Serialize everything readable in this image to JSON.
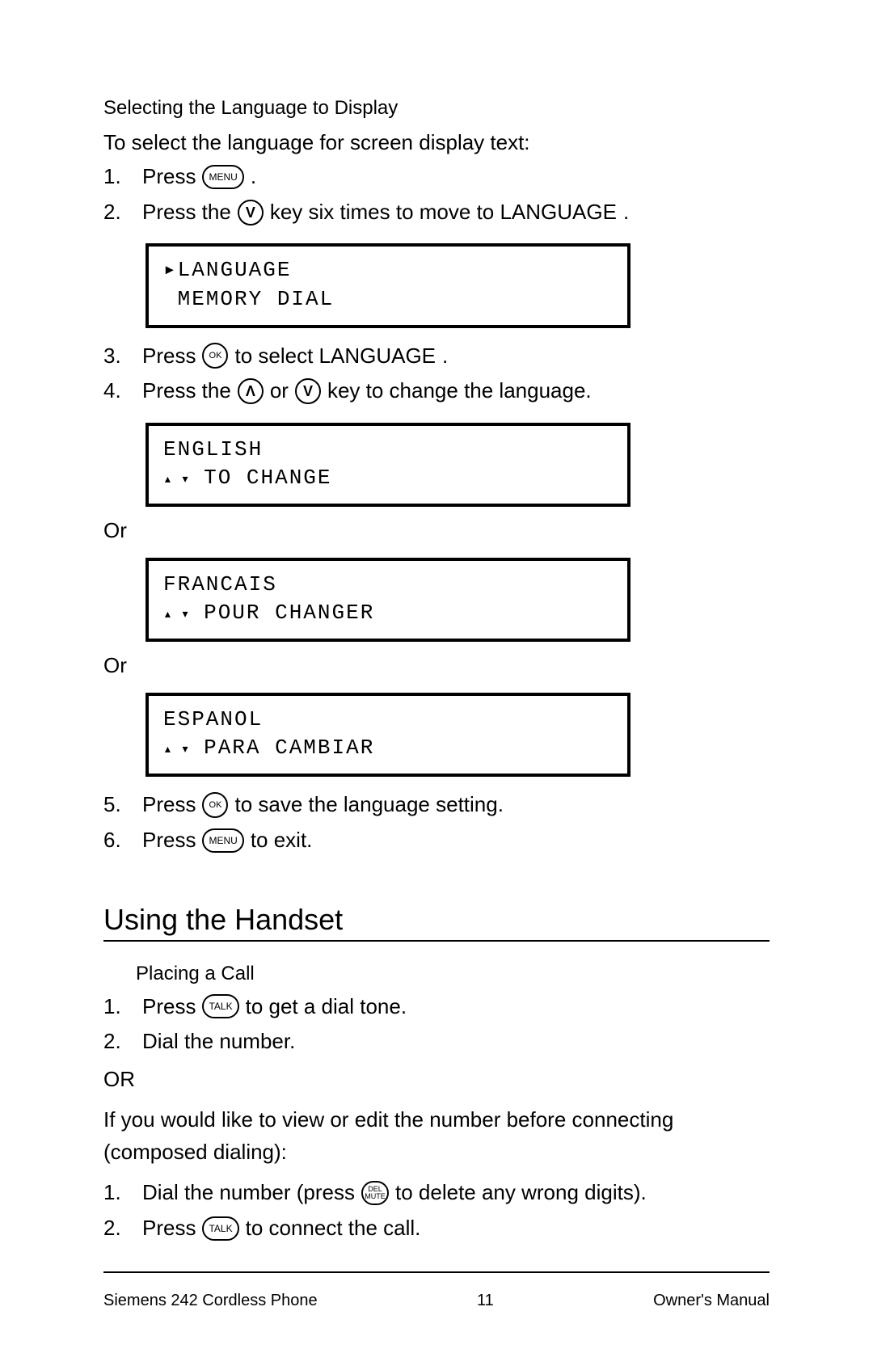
{
  "buttons": {
    "menu": "MENU",
    "down": "V",
    "up": "Λ",
    "ok": "OK",
    "talk": "TALK",
    "del_top": "DEL",
    "del_bot": "MUTE"
  },
  "sec1": {
    "heading": "Selecting the Language to Display",
    "intro": "To select the language for screen display text:",
    "step1_a": "1.",
    "step1_b": "Press",
    "step1_c": ".",
    "step2_a": "2.",
    "step2_b": "Press the",
    "step2_c": "key six times to move to LANGUAGE",
    "step2_d": ".",
    "lcd1_line1": "▸LANGUAGE",
    "lcd1_line2": " MEMORY DIAL",
    "step3_a": "3.",
    "step3_b": "Press",
    "step3_c": "to select LANGUAGE",
    "step3_d": ".",
    "step4_a": "4.",
    "step4_b": "Press the",
    "step4_c": "or",
    "step4_d": "key to change the language.",
    "lcd2_line1": "ENGLISH",
    "lcd2_line2_arrows": "▴ ▾",
    "lcd2_line2_text": " TO CHANGE",
    "or1": "Or",
    "lcd3_line1": "FRANCAIS",
    "lcd3_line2_arrows": "▴ ▾",
    "lcd3_line2_text": " POUR CHANGER",
    "or2": "Or",
    "lcd4_line1": "ESPANOL",
    "lcd4_line2_arrows": "▴ ▾",
    "lcd4_line2_text": " PARA CAMBIAR",
    "step5_a": "5.",
    "step5_b": "Press",
    "step5_c": "to save the language setting.",
    "step6_a": "6.",
    "step6_b": "Press",
    "step6_c": "to exit."
  },
  "sec2": {
    "heading": "Using the Handset",
    "subheading": "Placing a Call",
    "step1_a": "1.",
    "step1_b": "Press",
    "step1_c": "to get a dial tone.",
    "step2_a": "2.",
    "step2_b": "Dial the number.",
    "or": "OR",
    "pre": "If you would like to view or edit the number before connecting (composed dialing):",
    "cstep1_a": "1.",
    "cstep1_b": "Dial the number (press",
    "cstep1_c": "to delete any wrong digits).",
    "cstep2_a": "2.",
    "cstep2_b": "Press",
    "cstep2_c": "to connect the call."
  },
  "footer": {
    "left": "Siemens 242 Cordless Phone",
    "center": "11",
    "right": "Owner's Manual"
  }
}
